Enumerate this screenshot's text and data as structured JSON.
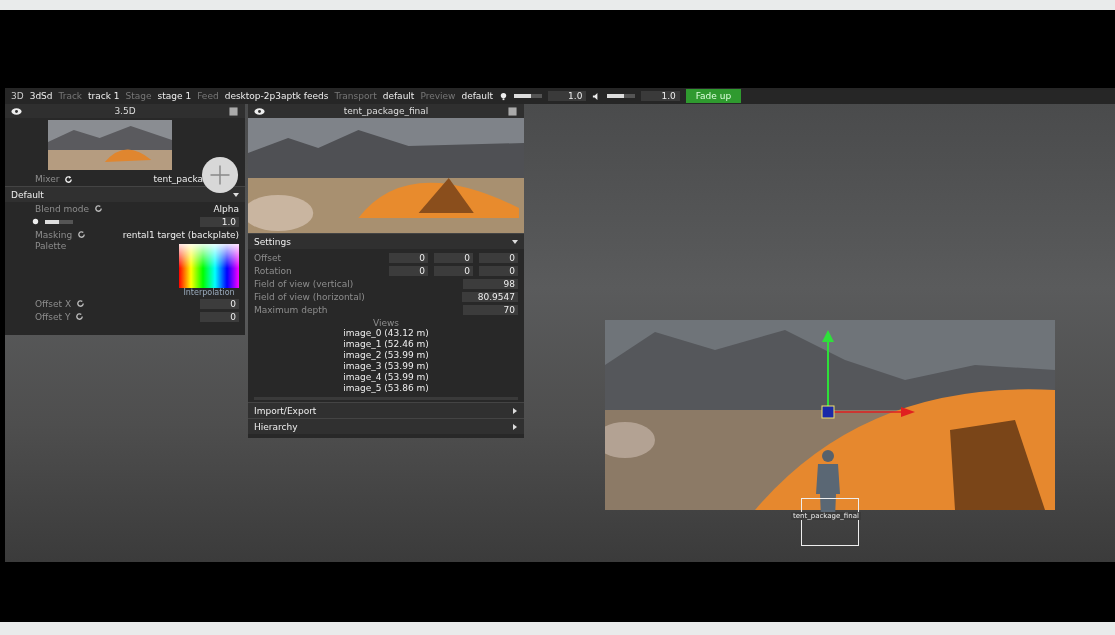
{
  "toolbar": {
    "mode": "3D",
    "app": "3dSd",
    "fields": [
      {
        "label": "Track",
        "value": "track 1"
      },
      {
        "label": "Stage",
        "value": "stage 1"
      },
      {
        "label": "Feed",
        "value": "desktop-2p3aptk feeds"
      },
      {
        "label": "Transport",
        "value": "default"
      },
      {
        "label": "Preview",
        "value": "default"
      }
    ],
    "sliders": [
      {
        "kind": "light",
        "level": 0.6,
        "reading": "1.0"
      },
      {
        "kind": "volume",
        "level": 0.6,
        "reading": "1.0"
      }
    ],
    "action_button": "Fade up"
  },
  "left_panel": {
    "title": "3.5D",
    "mixer_label": "Mixer",
    "layer_name": "tent_packa",
    "section": "Default",
    "rows": [
      {
        "kind": "select",
        "label": "Blend mode",
        "value": "Alpha"
      },
      {
        "kind": "slider",
        "level": 0.5,
        "value": "1.0"
      },
      {
        "kind": "select",
        "label": "Masking",
        "value": "rental1 target (backplate)"
      },
      {
        "kind": "color",
        "label": "Palette",
        "caption": "Interpolation"
      },
      {
        "kind": "number",
        "label": "Offset X",
        "value": "0"
      },
      {
        "kind": "number",
        "label": "Offset Y",
        "value": "0"
      }
    ]
  },
  "right_panel": {
    "title": "tent_package_final",
    "sections": [
      {
        "title": "Settings",
        "expanded": true,
        "vectors": [
          {
            "label": "Offset",
            "values": [
              "0",
              "0",
              "0"
            ]
          },
          {
            "label": "Rotation",
            "values": [
              "0",
              "0",
              "0"
            ]
          }
        ],
        "fields": [
          {
            "label": "Field of view (vertical)",
            "value": "98"
          },
          {
            "label": "Field of view (horizontal)",
            "value": "80.9547"
          },
          {
            "label": "Maximum depth",
            "value": "70"
          }
        ],
        "views_title": "Views",
        "views": [
          "image_0 (43.12 m)",
          "image_1 (52.46 m)",
          "image_2 (53.99 m)",
          "image_3 (53.99 m)",
          "image_4 (53.99 m)",
          "image_5 (53.86 m)"
        ]
      },
      {
        "title": "Import/Export",
        "expanded": false
      },
      {
        "title": "Hierarchy",
        "expanded": false
      }
    ]
  },
  "viewport": {
    "object_label": "tent_package_final"
  }
}
